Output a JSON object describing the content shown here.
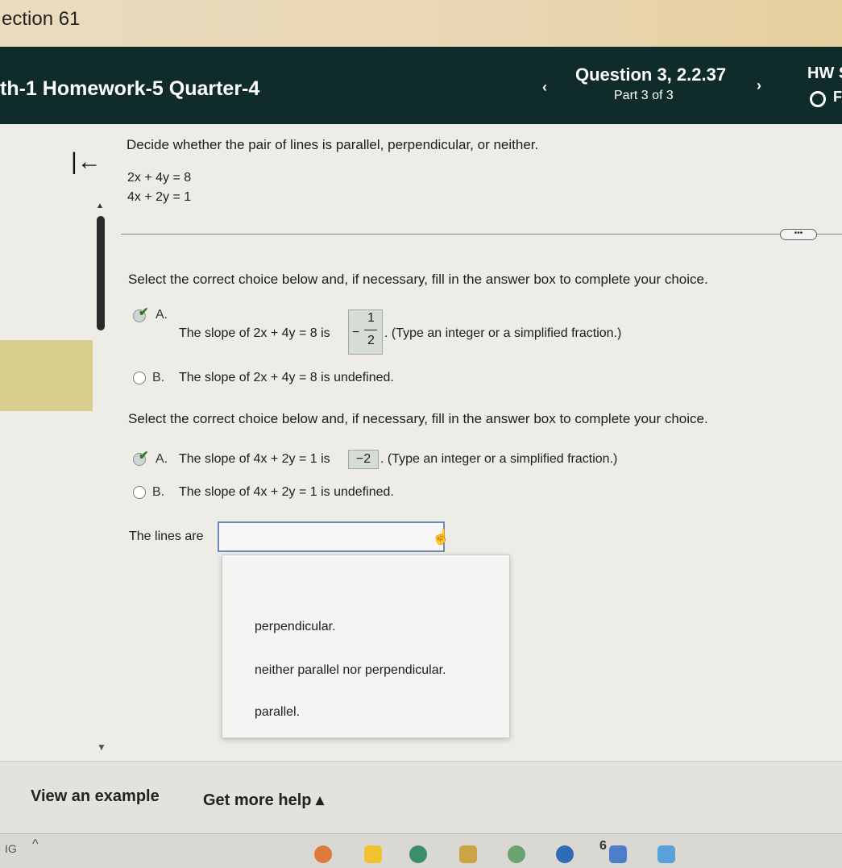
{
  "section_label": "ection 61",
  "header": {
    "homework_title": "th-1 Homework-5 Quarter-4",
    "question_title": "Question 3, 2.2.37",
    "question_part": "Part 3 of 3",
    "hw_score": "HW S",
    "status_extra": "F",
    "prev_glyph": "‹",
    "next_glyph": "›"
  },
  "problem": {
    "prompt": "Decide whether the pair of lines is parallel, perpendicular, or neither.",
    "equation_1": "2x + 4y = 8",
    "equation_2": "4x + 2y = 1",
    "more_label": "•••"
  },
  "part1": {
    "instruction": "Select the correct choice below and, if necessary, fill in the answer box to complete your choice.",
    "option_a_letter": "A.",
    "option_a_text_before": "The slope of 2x + 4y = 8 is",
    "option_a_answer_sign": "−",
    "option_a_answer_num": "1",
    "option_a_answer_den": "2",
    "option_a_text_after": ". (Type an integer or a simplified fraction.)",
    "option_b_letter": "B.",
    "option_b_text": "The slope of 2x + 4y = 8 is undefined."
  },
  "part2": {
    "instruction": "Select the correct choice below and, if necessary, fill in the answer box to complete your choice.",
    "option_a_letter": "A.",
    "option_a_text_before": "The slope of 4x + 2y = 1 is",
    "option_a_answer": "−2",
    "option_a_text_after": ". (Type an integer or a simplified fraction.)",
    "option_b_letter": "B.",
    "option_b_text": "The slope of 4x + 2y = 1 is undefined."
  },
  "part3": {
    "label": "The lines are",
    "selected_value": "",
    "dropdown_options": [
      "perpendicular.",
      "neither parallel nor perpendicular.",
      "parallel."
    ]
  },
  "footer": {
    "view_example": "View an example",
    "get_more_help": "Get more help ▴"
  },
  "taskbar": {
    "left_text": "IG",
    "caret": "^",
    "badge": "6"
  },
  "colors": {
    "header_bg": "#0f2b2a",
    "check_green": "#2a7a1f",
    "answer_box_bg": "#d7dcd4",
    "select_border": "#6d88b4"
  }
}
